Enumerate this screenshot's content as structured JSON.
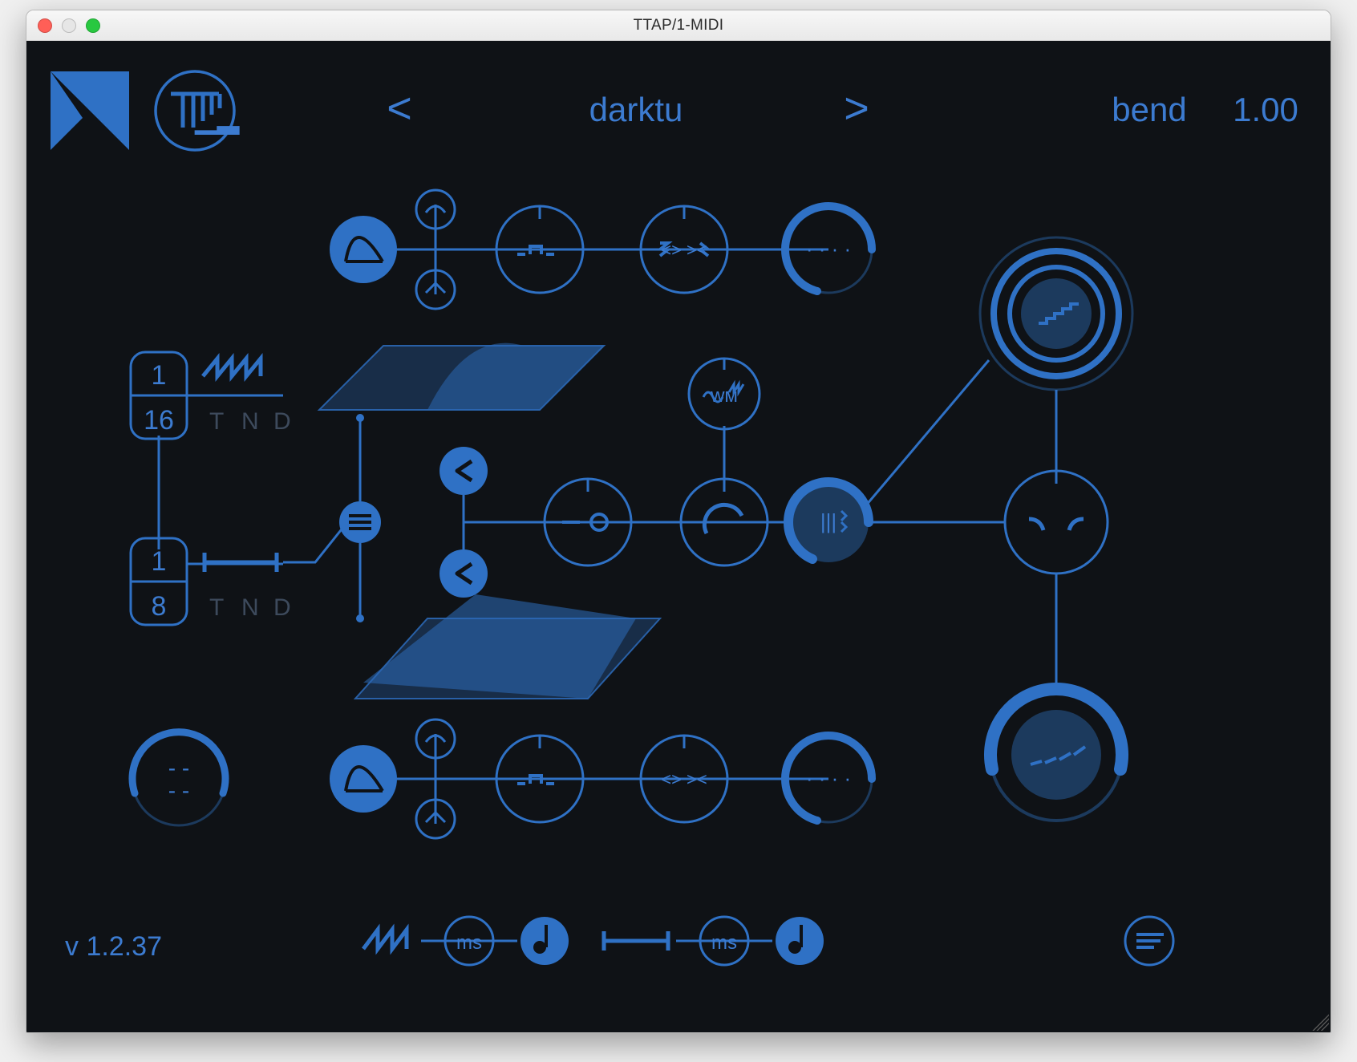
{
  "window": {
    "title": "TTAP/1-MIDI"
  },
  "colors": {
    "accent": "#2f71c5",
    "accent_dim": "#1c3a5d",
    "bg": "#0f1216"
  },
  "header": {
    "prev_label": "<",
    "preset_name": "darktu",
    "next_label": ">",
    "param_label": "bend",
    "param_value": "1.00"
  },
  "time_a": {
    "numerator": "1",
    "denominator": "16",
    "mode_T": "T",
    "mode_N": "N",
    "mode_D": "D"
  },
  "time_b": {
    "numerator": "1",
    "denominator": "8",
    "mode_T": "T",
    "mode_N": "N",
    "mode_D": "D"
  },
  "footer": {
    "version": "v 1.2.37",
    "unit1": "ms",
    "unit2": "ms"
  }
}
